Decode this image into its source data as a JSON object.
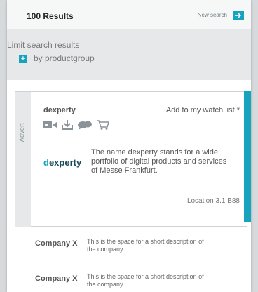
{
  "header": {
    "results": "100 Results",
    "new_search": "New search"
  },
  "filter": {
    "title": "Limit search results",
    "items": [
      {
        "label": "by productgroup"
      }
    ]
  },
  "advert": {
    "tab_label": "Advert",
    "company": "dexperty",
    "watch": "Add to my watch list *",
    "logo_d": "d",
    "logo_rest": "experty",
    "description": "The name dexperty stands for a wide portfolio of digital products and services of Messe Frankfurt.",
    "location": "Location 3.1 B88",
    "icons": [
      "video-icon",
      "download-icon",
      "chat-icon",
      "cart-icon"
    ]
  },
  "companies": [
    {
      "name": "Company X",
      "description": "This is the space for a short description of the company"
    },
    {
      "name": "Company X",
      "description": "This is the space for a short description of the company"
    }
  ],
  "colors": {
    "accent": "#16a3bd"
  }
}
